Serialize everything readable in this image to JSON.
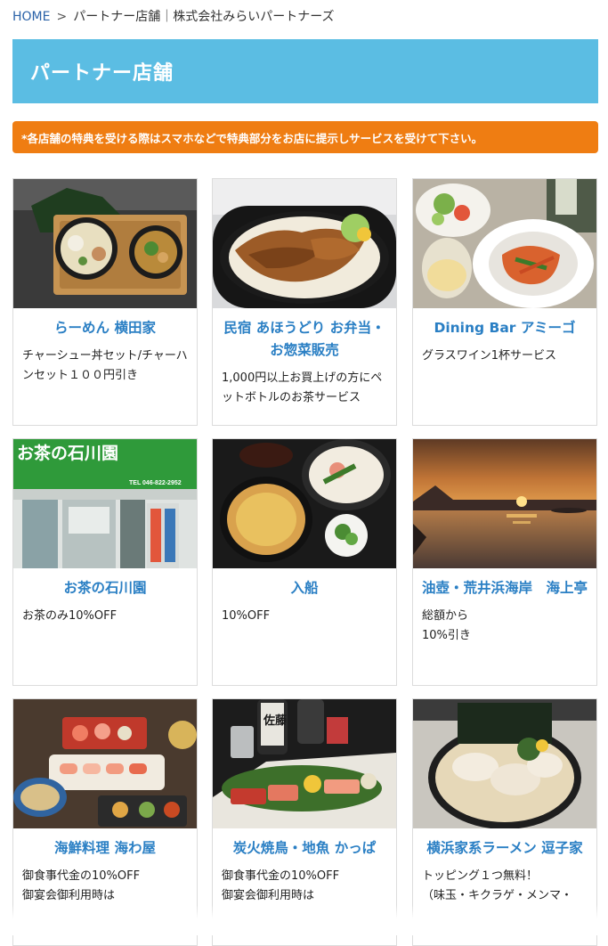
{
  "breadcrumb": {
    "home": "HOME",
    "separator": ">",
    "current": "パートナー店舗｜株式会社みらいパートナーズ"
  },
  "header": {
    "title": "パートナー店舗"
  },
  "notice": {
    "text": "*各店舗の特典を受ける際はスマホなどで特典部分をお店に提示しサービスを受けて下さい。"
  },
  "colors": {
    "header_bg": "#5bbde3",
    "notice_bg": "#ef7d12",
    "title_link": "#2a7fc4"
  },
  "cards": [
    {
      "title": "らーめん 横田家",
      "desc": "チャーシュー丼セット/チャーハンセット１００円引き"
    },
    {
      "title": "民宿 あほうどり お弁当・お惣菜販売",
      "desc": "1,000円以上お買上げの方にペットボトルのお茶サービス"
    },
    {
      "title": "Dining Bar アミーゴ",
      "desc": "グラスワイン1杯サービス"
    },
    {
      "title": "お茶の石川園",
      "desc": "お茶のみ10%OFF"
    },
    {
      "title": "入船",
      "desc": "10%OFF"
    },
    {
      "title": "油壺・荒井浜海岸　海上亭",
      "desc": "総額から\n10%引き"
    },
    {
      "title": "海鮮料理 海わ屋",
      "desc": "御食事代金の10%OFF\n御宴会御利用時は"
    },
    {
      "title": "炭火焼鳥・地魚 かっぱ",
      "desc": "御食事代金の10%OFF\n御宴会御利用時は"
    },
    {
      "title": "横浜家系ラーメン 逗子家",
      "desc": "トッピング１つ無料！\n（味玉・キクラゲ・メンマ・"
    }
  ],
  "shop_sign": {
    "name": "お茶の石川園",
    "tel": "TEL 046-822-2952"
  },
  "bottle_label": "佐藤"
}
